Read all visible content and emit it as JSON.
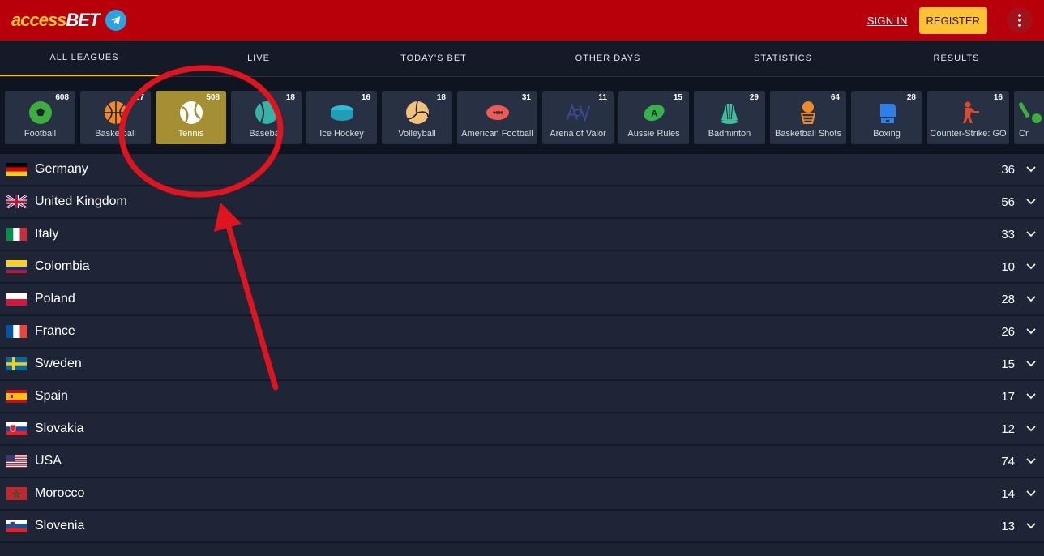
{
  "header": {
    "logo_prefix": "access",
    "logo_suffix": "BET",
    "signin_label": "SIGN IN",
    "register_label": "REGISTER"
  },
  "nav": {
    "tabs": [
      {
        "label": "ALL LEAGUES"
      },
      {
        "label": "LIVE"
      },
      {
        "label": "TODAY'S BET"
      },
      {
        "label": "OTHER DAYS"
      },
      {
        "label": "STATISTICS"
      },
      {
        "label": "RESULTS"
      }
    ]
  },
  "sports": [
    {
      "label": "Football",
      "count": "608",
      "icon": "football-icon"
    },
    {
      "label": "Basketball",
      "count": "17",
      "icon": "basketball-icon"
    },
    {
      "label": "Tennis",
      "count": "508",
      "icon": "tennis-icon",
      "active": true
    },
    {
      "label": "Baseball",
      "count": "18",
      "icon": "baseball-icon"
    },
    {
      "label": "Ice Hockey",
      "count": "16",
      "icon": "ice-hockey-icon"
    },
    {
      "label": "Volleyball",
      "count": "18",
      "icon": "volleyball-icon"
    },
    {
      "label": "American Football",
      "count": "31",
      "icon": "american-football-icon"
    },
    {
      "label": "Arena of Valor",
      "count": "11",
      "icon": "arena-of-valor-icon"
    },
    {
      "label": "Aussie Rules",
      "count": "15",
      "icon": "aussie-rules-icon"
    },
    {
      "label": "Badminton",
      "count": "29",
      "icon": "badminton-icon"
    },
    {
      "label": "Basketball Shots",
      "count": "64",
      "icon": "basketball-shots-icon"
    },
    {
      "label": "Boxing",
      "count": "28",
      "icon": "boxing-icon"
    },
    {
      "label": "Counter-Strike: GO",
      "count": "16",
      "icon": "counter-strike-icon"
    },
    {
      "label": "Cr",
      "count": "",
      "icon": "cricket-icon"
    }
  ],
  "countries": [
    {
      "name": "Germany",
      "count": "36"
    },
    {
      "name": "United Kingdom",
      "count": "56"
    },
    {
      "name": "Italy",
      "count": "33"
    },
    {
      "name": "Colombia",
      "count": "10"
    },
    {
      "name": "Poland",
      "count": "28"
    },
    {
      "name": "France",
      "count": "26"
    },
    {
      "name": "Sweden",
      "count": "15"
    },
    {
      "name": "Spain",
      "count": "17"
    },
    {
      "name": "Slovakia",
      "count": "12"
    },
    {
      "name": "USA",
      "count": "74"
    },
    {
      "name": "Morocco",
      "count": "14"
    },
    {
      "name": "Slovenia",
      "count": "13"
    }
  ],
  "colors": {
    "header_red": "#b8000b",
    "accent_yellow": "#ffc233",
    "active_tile": "#a58f33",
    "annotation_red": "#e0141e"
  }
}
